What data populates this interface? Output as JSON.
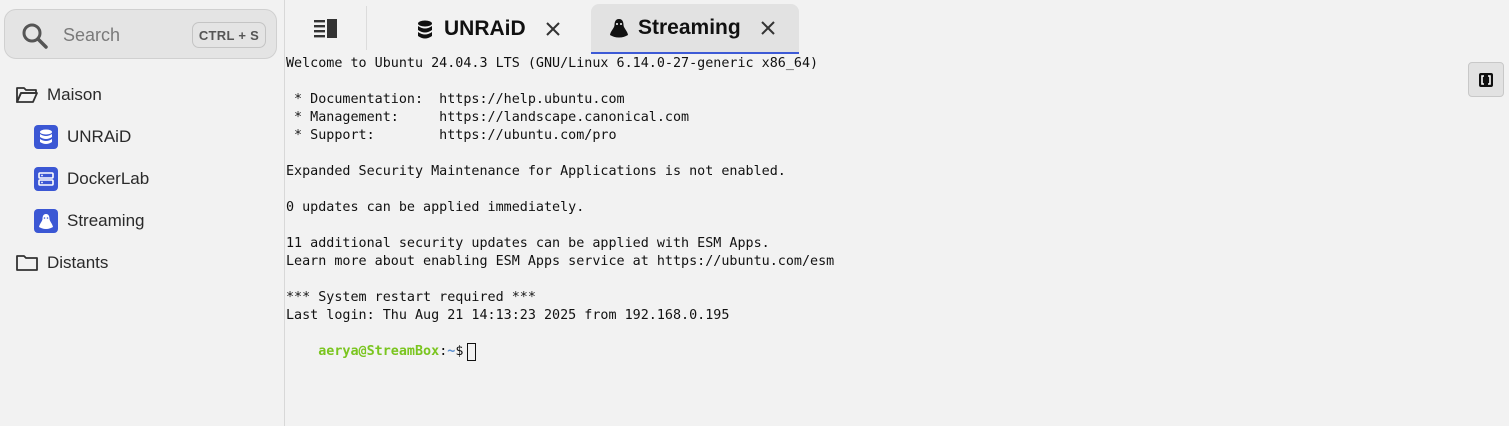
{
  "search": {
    "placeholder": "Search",
    "shortcut": "CTRL + S"
  },
  "sidebar": {
    "groups": [
      {
        "label": "Maison",
        "open": true
      },
      {
        "label": "Distants",
        "open": false
      }
    ],
    "hosts": [
      {
        "label": "UNRAiD",
        "icon": "database-icon"
      },
      {
        "label": "DockerLab",
        "icon": "server-icon"
      },
      {
        "label": "Streaming",
        "icon": "linux-tux-icon"
      }
    ]
  },
  "tabs": [
    {
      "label": "UNRAiD",
      "icon": "database-icon",
      "active": false
    },
    {
      "label": "Streaming",
      "icon": "linux-tux-icon",
      "active": true
    }
  ],
  "terminal": {
    "lines": [
      "Welcome to Ubuntu 24.04.3 LTS (GNU/Linux 6.14.0-27-generic x86_64)",
      "",
      " * Documentation:  https://help.ubuntu.com",
      " * Management:     https://landscape.canonical.com",
      " * Support:        https://ubuntu.com/pro",
      "",
      "Expanded Security Maintenance for Applications is not enabled.",
      "",
      "0 updates can be applied immediately.",
      "",
      "11 additional security updates can be applied with ESM Apps.",
      "Learn more about enabling ESM Apps service at https://ubuntu.com/esm",
      "",
      "*** System restart required ***",
      "Last login: Thu Aug 21 14:13:23 2025 from 192.168.0.195"
    ],
    "prompt_user": "aerya@StreamBox",
    "prompt_sep": ":",
    "prompt_path": "~",
    "prompt_symbol": "$"
  },
  "colors": {
    "accent": "#3b57d4",
    "prompt_user": "#7ac51f",
    "prompt_path": "#5a8fd0"
  }
}
